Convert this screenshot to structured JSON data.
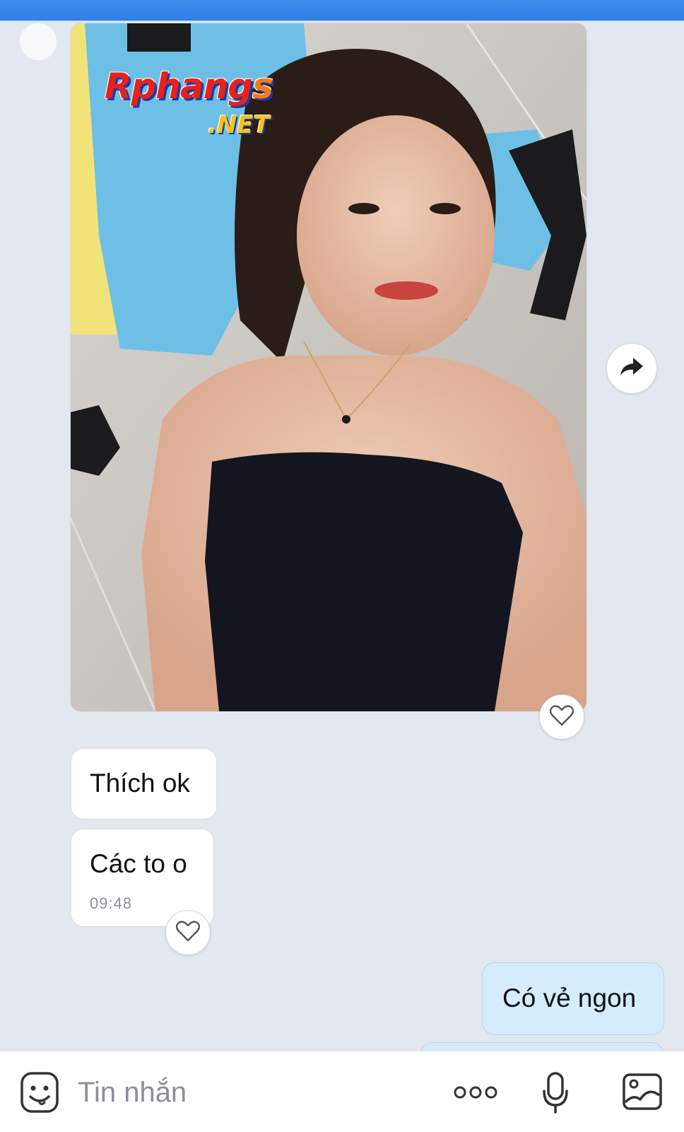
{
  "header": {
    "title": ""
  },
  "watermark": {
    "main": "Rphangs",
    "sub": ".NET"
  },
  "messages": [
    {
      "from": "other",
      "type": "photo"
    },
    {
      "from": "other",
      "type": "text",
      "text": "Thích ok"
    },
    {
      "from": "other",
      "type": "text",
      "text": "Các to o",
      "time": "09:48"
    },
    {
      "from": "me",
      "type": "text",
      "text": "Có vẻ ngon"
    }
  ],
  "composer": {
    "placeholder": "Tin nhắn"
  },
  "icons": {
    "forward": "share-arrow-icon",
    "react": "heart-outline-icon",
    "sticker": "sticker-icon",
    "more": "more-dots-icon",
    "voice": "microphone-icon",
    "image": "image-icon"
  },
  "colors": {
    "header": "#2f7fe8",
    "background": "#e3e8f0",
    "my_bubble": "#d5ecfd",
    "other_bubble": "#ffffff"
  }
}
